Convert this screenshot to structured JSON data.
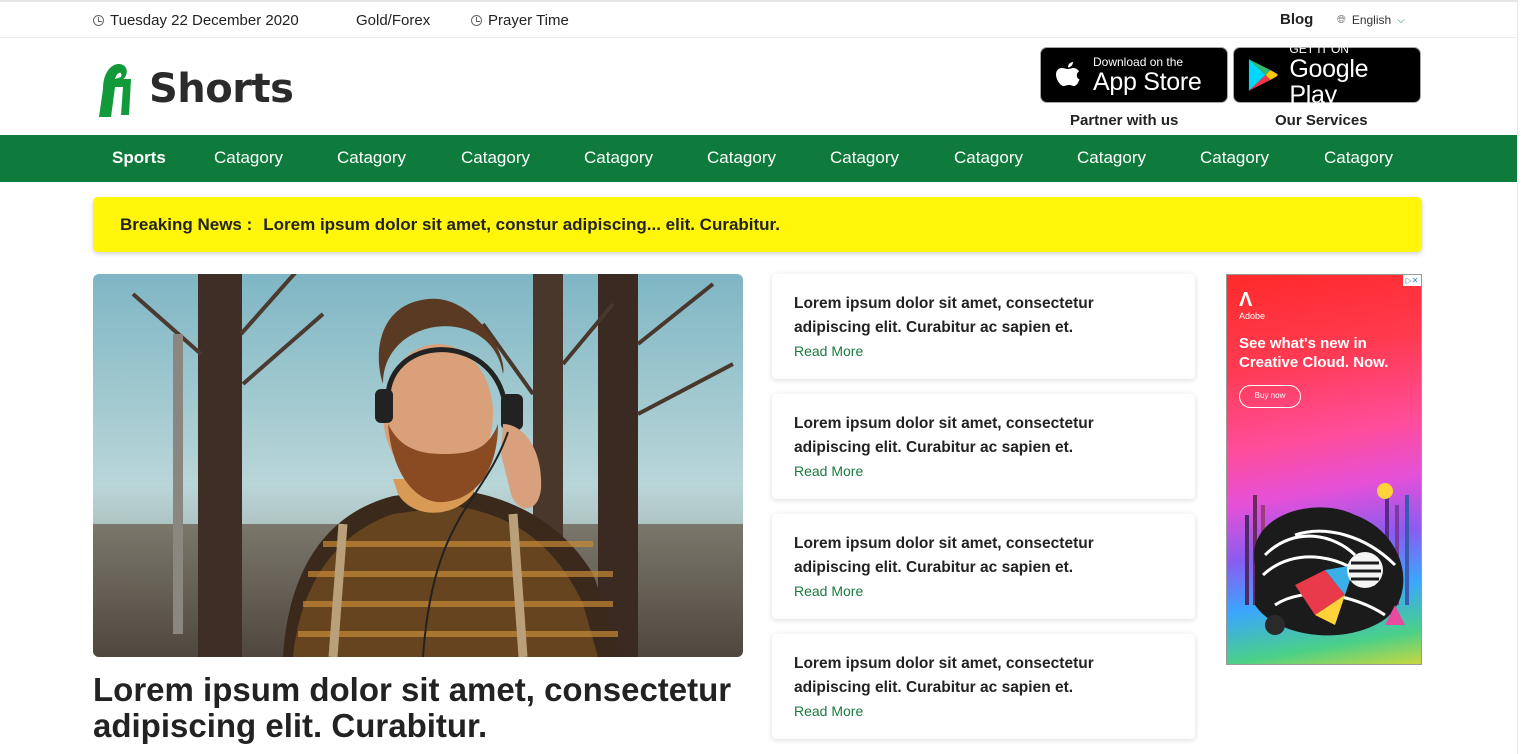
{
  "topbar": {
    "date": "Tuesday 22 December 2020",
    "gold_forex": "Gold/Forex",
    "prayer_time": "Prayer Time",
    "blog": "Blog",
    "language": "English"
  },
  "header": {
    "logo_text": "Shorts",
    "app_store": {
      "small": "Download on the",
      "big": "App Store"
    },
    "google_play": {
      "small": "GET IT ON",
      "big": "Google Play"
    },
    "partner": "Partner with us",
    "services": "Our Services"
  },
  "nav": {
    "items": [
      "Sports",
      "Catagory",
      "Catagory",
      "Catagory",
      "Catagory",
      "Catagory",
      "Catagory",
      "Catagory",
      "Catagory",
      "Catagory",
      "Catagory"
    ],
    "active": "Sports",
    "bg_color": "#0e7a3b"
  },
  "breaking": {
    "label": "Breaking News :",
    "text": "Lorem ipsum dolor sit amet, constur adipiscing... elit. Curabitur.",
    "bg_color": "#fff60a"
  },
  "hero": {
    "title": "Lorem ipsum dolor sit amet, consectetur adipiscing elit. Curabitur."
  },
  "cards": [
    {
      "title": "Lorem ipsum dolor sit amet, consectetur adipiscing elit. Curabitur ac sapien et.",
      "link": "Read More"
    },
    {
      "title": "Lorem ipsum dolor sit amet, consectetur adipiscing elit. Curabitur ac sapien et.",
      "link": "Read More"
    },
    {
      "title": "Lorem ipsum dolor sit amet, consectetur adipiscing elit. Curabitur ac sapien et.",
      "link": "Read More"
    },
    {
      "title": "Lorem ipsum dolor sit amet, consectetur adipiscing elit. Curabitur ac sapien et.",
      "link": "Read More"
    }
  ],
  "ad": {
    "brand": "Adobe",
    "headline": "See what's new in Creative Cloud. Now.",
    "button": "Buy now"
  }
}
